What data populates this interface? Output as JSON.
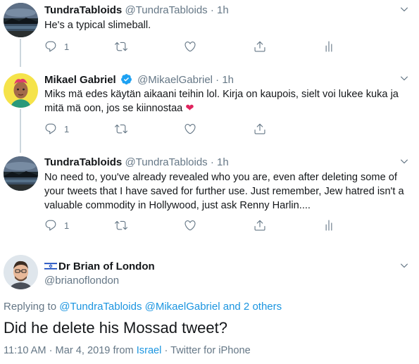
{
  "tweets": [
    {
      "name": "TundraTabloids",
      "handle": "@TundraTabloids",
      "dot": "·",
      "time": "1h",
      "text": "He's a typical slimeball.",
      "reply_count": "1",
      "has_analytics": true,
      "avatar": "night-landscape"
    },
    {
      "name": "Mikael Gabriel",
      "handle": "@MikaelGabriel",
      "dot": "·",
      "time": "1h",
      "verified": true,
      "text_line1": "Miks mä edes käytän aikaani teihin lol. Kirja on kaupois, sielt voi lukee kuka ja",
      "text_line2": "mitä mä oon, jos se kiinnostaa",
      "emoji": "❤",
      "reply_count": "1",
      "has_analytics": false,
      "avatar": "cartoon-portrait"
    },
    {
      "name": "TundraTabloids",
      "handle": "@TundraTabloids",
      "dot": "·",
      "time": "1h",
      "text_line1": "No need to, you've already revealed who you are, even after deleting some of",
      "text_line2": "your tweets that I have saved for further use. Just remember, Jew hatred isn't a",
      "text_line3": "valuable commodity in Hollywood, just ask Renny Harlin....",
      "reply_count": "1",
      "has_analytics": true,
      "avatar": "night-landscape"
    }
  ],
  "main_tweet": {
    "flag": "israel-flag",
    "name": "Dr Brian of London",
    "handle": "@brianoflondon",
    "replying_prefix": "Replying to",
    "replying_to_1": "@TundraTabloids",
    "replying_to_2": "@MikaelGabriel",
    "replying_others": "and 2 others",
    "text": "Did he delete his Mossad tweet?",
    "timestamp": "11:10 AM · Mar 4, 2019 from",
    "location": "Israel",
    "source": "· Twitter for iPhone"
  },
  "colors": {
    "link": "#1b95e0",
    "muted": "#657786",
    "text": "#14171a",
    "heart": "#e0245e",
    "verified": "#1da1f2"
  },
  "icons": [
    "reply-icon",
    "retweet-icon",
    "like-icon",
    "share-icon",
    "analytics-icon",
    "chevron-down-icon",
    "verified-badge-icon"
  ]
}
